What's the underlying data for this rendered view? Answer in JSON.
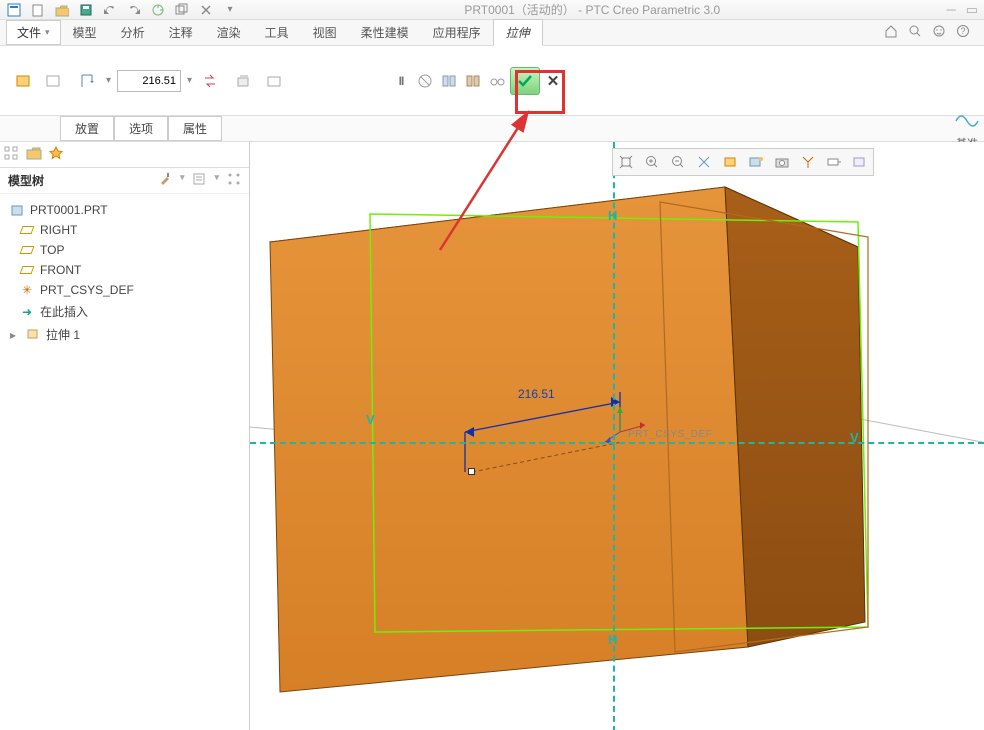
{
  "titlebar": {
    "title": "PRT0001（活动的） - PTC Creo Parametric 3.0"
  },
  "menus": {
    "file": "文件",
    "tabs": [
      "模型",
      "分析",
      "注释",
      "渲染",
      "工具",
      "视图",
      "柔性建模",
      "应用程序",
      "拉伸"
    ],
    "active_index": 8
  },
  "ribbon": {
    "depth_value": "216.51",
    "sidepanel": "基准"
  },
  "subtabs": [
    "放置",
    "选项",
    "属性"
  ],
  "tree": {
    "title": "模型树",
    "root": "PRT0001.PRT",
    "items": [
      {
        "label": "RIGHT",
        "icon": "plane"
      },
      {
        "label": "TOP",
        "icon": "plane"
      },
      {
        "label": "FRONT",
        "icon": "plane"
      },
      {
        "label": "PRT_CSYS_DEF",
        "icon": "csys"
      },
      {
        "label": "在此插入",
        "icon": "insert"
      }
    ],
    "feature": "拉伸 1"
  },
  "viewport": {
    "dim_label": "216.51",
    "csys_label": "PRT_CSYS_DEF",
    "axis_h": "H",
    "axis_v": "V"
  }
}
